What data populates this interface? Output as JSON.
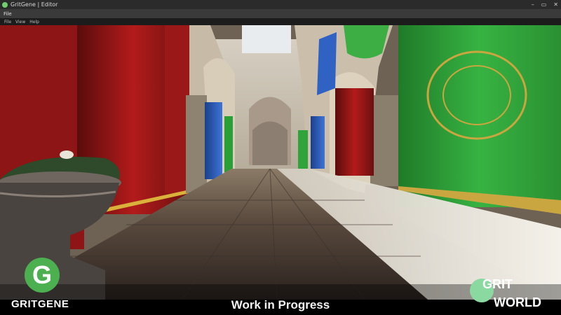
{
  "window": {
    "title": "GritGene | Editor",
    "controls": [
      "–",
      "▭",
      "✕"
    ]
  },
  "menubar_outer": {
    "items": [
      "File"
    ]
  },
  "menubar_inner": {
    "items": [
      "File",
      "View",
      "Help"
    ]
  },
  "overlay": {
    "caption": "Work in Progress",
    "logo_left": {
      "glyph": "G",
      "name": "GRITGENE"
    },
    "logo_right": {
      "line1": "GRIT",
      "line2": "WORLD"
    }
  },
  "colors": {
    "green_accent": "#4caf50",
    "curtain_red": "#b31b1b",
    "curtain_green": "#2fa83a",
    "curtain_blue": "#2b5fc0"
  }
}
